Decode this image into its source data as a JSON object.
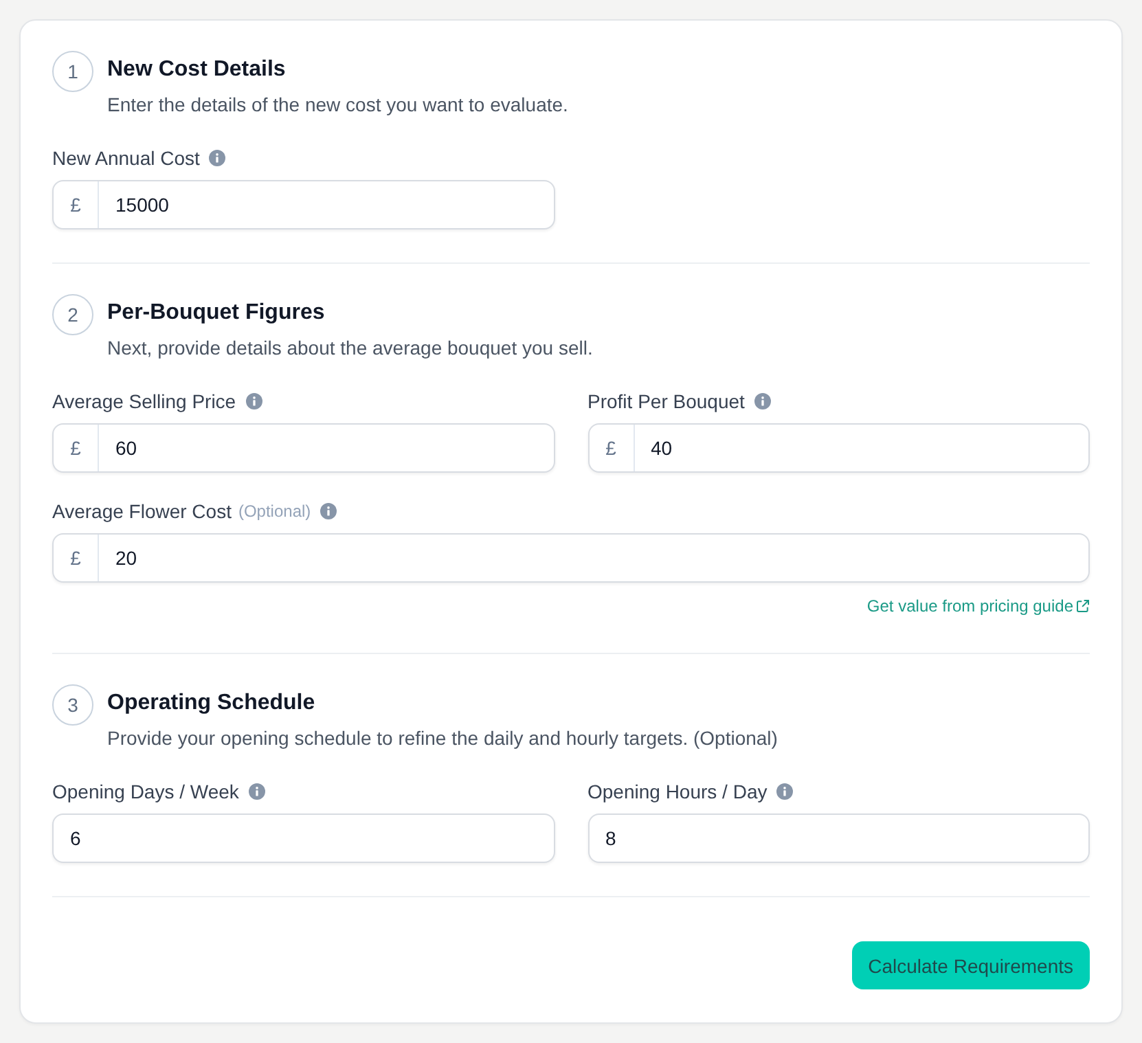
{
  "sections": [
    {
      "number": "1",
      "title": "New Cost Details",
      "description": "Enter the details of the new cost you want to evaluate.",
      "fields": [
        {
          "label": "New Annual Cost",
          "prefix": "£",
          "value": "15000",
          "wide": false
        }
      ]
    },
    {
      "number": "2",
      "title": "Per-Bouquet Figures",
      "description": "Next, provide details about the average bouquet you sell.",
      "fields": [
        {
          "label": "Average Selling Price",
          "prefix": "£",
          "value": "60",
          "wide": false
        },
        {
          "label": "Profit Per Bouquet",
          "prefix": "£",
          "value": "40",
          "wide": false
        },
        {
          "label": "Average Flower Cost",
          "note": "(Optional)",
          "prefix": "£",
          "value": "20",
          "wide": true,
          "link": "Get value from pricing guide"
        }
      ]
    },
    {
      "number": "3",
      "title": "Operating Schedule",
      "description": "Provide your opening schedule to refine the daily and hourly targets. (Optional)",
      "fields": [
        {
          "label": "Opening Days / Week",
          "value": "6",
          "wide": false
        },
        {
          "label": "Opening Hours / Day",
          "value": "8",
          "wide": false
        }
      ]
    }
  ],
  "submit_button": {
    "label": "Calculate Requirements"
  }
}
